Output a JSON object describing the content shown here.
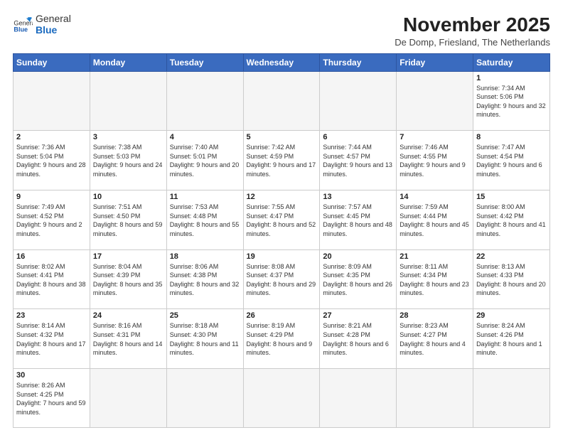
{
  "header": {
    "logo_general": "General",
    "logo_blue": "Blue",
    "month_title": "November 2025",
    "subtitle": "De Domp, Friesland, The Netherlands"
  },
  "weekdays": [
    "Sunday",
    "Monday",
    "Tuesday",
    "Wednesday",
    "Thursday",
    "Friday",
    "Saturday"
  ],
  "weeks": [
    [
      {
        "day": "",
        "info": ""
      },
      {
        "day": "",
        "info": ""
      },
      {
        "day": "",
        "info": ""
      },
      {
        "day": "",
        "info": ""
      },
      {
        "day": "",
        "info": ""
      },
      {
        "day": "",
        "info": ""
      },
      {
        "day": "1",
        "info": "Sunrise: 7:34 AM\nSunset: 5:06 PM\nDaylight: 9 hours and 32 minutes."
      }
    ],
    [
      {
        "day": "2",
        "info": "Sunrise: 7:36 AM\nSunset: 5:04 PM\nDaylight: 9 hours and 28 minutes."
      },
      {
        "day": "3",
        "info": "Sunrise: 7:38 AM\nSunset: 5:03 PM\nDaylight: 9 hours and 24 minutes."
      },
      {
        "day": "4",
        "info": "Sunrise: 7:40 AM\nSunset: 5:01 PM\nDaylight: 9 hours and 20 minutes."
      },
      {
        "day": "5",
        "info": "Sunrise: 7:42 AM\nSunset: 4:59 PM\nDaylight: 9 hours and 17 minutes."
      },
      {
        "day": "6",
        "info": "Sunrise: 7:44 AM\nSunset: 4:57 PM\nDaylight: 9 hours and 13 minutes."
      },
      {
        "day": "7",
        "info": "Sunrise: 7:46 AM\nSunset: 4:55 PM\nDaylight: 9 hours and 9 minutes."
      },
      {
        "day": "8",
        "info": "Sunrise: 7:47 AM\nSunset: 4:54 PM\nDaylight: 9 hours and 6 minutes."
      }
    ],
    [
      {
        "day": "9",
        "info": "Sunrise: 7:49 AM\nSunset: 4:52 PM\nDaylight: 9 hours and 2 minutes."
      },
      {
        "day": "10",
        "info": "Sunrise: 7:51 AM\nSunset: 4:50 PM\nDaylight: 8 hours and 59 minutes."
      },
      {
        "day": "11",
        "info": "Sunrise: 7:53 AM\nSunset: 4:48 PM\nDaylight: 8 hours and 55 minutes."
      },
      {
        "day": "12",
        "info": "Sunrise: 7:55 AM\nSunset: 4:47 PM\nDaylight: 8 hours and 52 minutes."
      },
      {
        "day": "13",
        "info": "Sunrise: 7:57 AM\nSunset: 4:45 PM\nDaylight: 8 hours and 48 minutes."
      },
      {
        "day": "14",
        "info": "Sunrise: 7:59 AM\nSunset: 4:44 PM\nDaylight: 8 hours and 45 minutes."
      },
      {
        "day": "15",
        "info": "Sunrise: 8:00 AM\nSunset: 4:42 PM\nDaylight: 8 hours and 41 minutes."
      }
    ],
    [
      {
        "day": "16",
        "info": "Sunrise: 8:02 AM\nSunset: 4:41 PM\nDaylight: 8 hours and 38 minutes."
      },
      {
        "day": "17",
        "info": "Sunrise: 8:04 AM\nSunset: 4:39 PM\nDaylight: 8 hours and 35 minutes."
      },
      {
        "day": "18",
        "info": "Sunrise: 8:06 AM\nSunset: 4:38 PM\nDaylight: 8 hours and 32 minutes."
      },
      {
        "day": "19",
        "info": "Sunrise: 8:08 AM\nSunset: 4:37 PM\nDaylight: 8 hours and 29 minutes."
      },
      {
        "day": "20",
        "info": "Sunrise: 8:09 AM\nSunset: 4:35 PM\nDaylight: 8 hours and 26 minutes."
      },
      {
        "day": "21",
        "info": "Sunrise: 8:11 AM\nSunset: 4:34 PM\nDaylight: 8 hours and 23 minutes."
      },
      {
        "day": "22",
        "info": "Sunrise: 8:13 AM\nSunset: 4:33 PM\nDaylight: 8 hours and 20 minutes."
      }
    ],
    [
      {
        "day": "23",
        "info": "Sunrise: 8:14 AM\nSunset: 4:32 PM\nDaylight: 8 hours and 17 minutes."
      },
      {
        "day": "24",
        "info": "Sunrise: 8:16 AM\nSunset: 4:31 PM\nDaylight: 8 hours and 14 minutes."
      },
      {
        "day": "25",
        "info": "Sunrise: 8:18 AM\nSunset: 4:30 PM\nDaylight: 8 hours and 11 minutes."
      },
      {
        "day": "26",
        "info": "Sunrise: 8:19 AM\nSunset: 4:29 PM\nDaylight: 8 hours and 9 minutes."
      },
      {
        "day": "27",
        "info": "Sunrise: 8:21 AM\nSunset: 4:28 PM\nDaylight: 8 hours and 6 minutes."
      },
      {
        "day": "28",
        "info": "Sunrise: 8:23 AM\nSunset: 4:27 PM\nDaylight: 8 hours and 4 minutes."
      },
      {
        "day": "29",
        "info": "Sunrise: 8:24 AM\nSunset: 4:26 PM\nDaylight: 8 hours and 1 minute."
      }
    ],
    [
      {
        "day": "30",
        "info": "Sunrise: 8:26 AM\nSunset: 4:25 PM\nDaylight: 7 hours and 59 minutes."
      },
      {
        "day": "",
        "info": ""
      },
      {
        "day": "",
        "info": ""
      },
      {
        "day": "",
        "info": ""
      },
      {
        "day": "",
        "info": ""
      },
      {
        "day": "",
        "info": ""
      },
      {
        "day": "",
        "info": ""
      }
    ]
  ]
}
